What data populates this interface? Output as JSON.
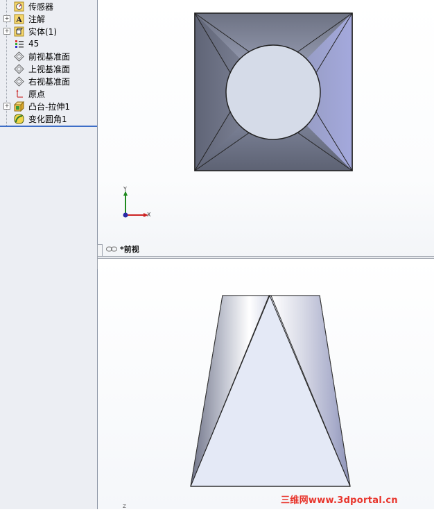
{
  "feature_tree": {
    "items": [
      {
        "label": "传感器",
        "icon": "sensor-icon",
        "expandable": false
      },
      {
        "label": "注解",
        "icon": "annotation-icon",
        "expandable": true
      },
      {
        "label": "实体(1)",
        "icon": "solid-bodies-icon",
        "expandable": true
      },
      {
        "label": "45",
        "icon": "material-icon",
        "expandable": false
      },
      {
        "label": "前视基准面",
        "icon": "plane-icon",
        "expandable": false
      },
      {
        "label": "上视基准面",
        "icon": "plane-icon",
        "expandable": false
      },
      {
        "label": "右视基准面",
        "icon": "plane-icon",
        "expandable": false
      },
      {
        "label": "原点",
        "icon": "origin-icon",
        "expandable": false
      },
      {
        "label": "凸台-拉伸1",
        "icon": "extrude-icon",
        "expandable": true
      },
      {
        "label": "变化圆角1",
        "icon": "fillet-icon",
        "expandable": false
      }
    ]
  },
  "viewports": {
    "top_view_label": "*前视",
    "triad": {
      "x_label": "X",
      "y_label": "Y",
      "z_label": "Z"
    }
  },
  "watermark": "三维网www.3dportal.cn",
  "colors": {
    "panel_bg": "#eceef3",
    "rollback_bar": "#3d6ec7",
    "watermark": "#e8342b",
    "model_face": "#e4e9f5",
    "model_dark": "#6a6f82"
  }
}
